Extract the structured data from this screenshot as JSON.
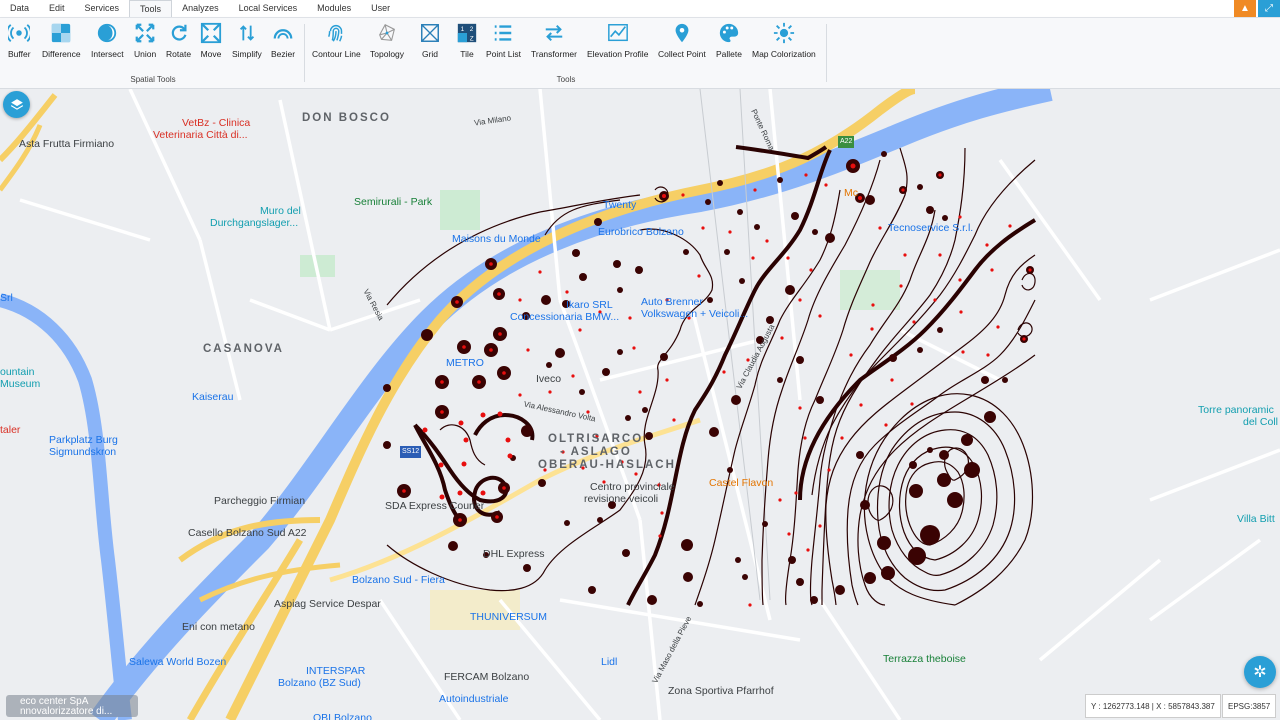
{
  "menu": {
    "tabs": [
      "Data",
      "Edit",
      "Services",
      "Tools",
      "Analyzes",
      "Local Services",
      "Modules",
      "User"
    ],
    "active_tab": "Tools"
  },
  "ribbon": {
    "spatial_tools": {
      "label": "Spatial Tools",
      "items": [
        {
          "label": "Buffer",
          "icon": "buffer-icon"
        },
        {
          "label": "Difference",
          "icon": "difference-icon"
        },
        {
          "label": "Intersect",
          "icon": "intersect-icon"
        },
        {
          "label": "Union",
          "icon": "union-icon"
        },
        {
          "label": "Rotate",
          "icon": "rotate-icon"
        },
        {
          "label": "Move",
          "icon": "move-icon"
        },
        {
          "label": "Simplify",
          "icon": "simplify-icon"
        },
        {
          "label": "Bezier",
          "icon": "bezier-icon"
        }
      ]
    },
    "tools": {
      "label": "Tools",
      "items": [
        {
          "label": "Contour Line",
          "icon": "fingerprint-icon"
        },
        {
          "label": "Topology",
          "icon": "topology-icon"
        },
        {
          "label": "Grid",
          "icon": "grid-icon"
        },
        {
          "label": "Tile",
          "icon": "tile-icon"
        },
        {
          "label": "Point List",
          "icon": "list-icon"
        },
        {
          "label": "Transformer",
          "icon": "transform-icon"
        },
        {
          "label": "Elevation Profile",
          "icon": "chart-icon"
        },
        {
          "label": "Collect Point",
          "icon": "pin-icon"
        },
        {
          "label": "Pallete",
          "icon": "palette-icon"
        },
        {
          "label": "Map Colorization",
          "icon": "sun-icon"
        }
      ]
    }
  },
  "map": {
    "districts": {
      "don_bosco": "DON BOSCO",
      "casanova": "CASANOVA",
      "oltrisarco_1": "OLTRISARCO",
      "oltrisarco_2": "- ASLAGO",
      "oltrisarco_3": "OBERAU-HASLACH"
    },
    "places": {
      "vetbz_1": "VetBz - Clinica",
      "vetbz_2": "Veterinaria Città di...",
      "asta": "Asta Frutta Firmiano",
      "muro_1": "Muro del",
      "muro_2": "Durchgangslager...",
      "semirurali": "Semirurali - Park",
      "maisons": "Maisons du Monde",
      "twenty": "Twenty",
      "eurobrico": "Eurobrico Bolzano",
      "tecnoservice": "Tecnoservice S.r.l.",
      "ikaro_1": "Ikaro SRL",
      "ikaro_2": "Concessionaria BMW...",
      "brenner_1": "Auto Brenner",
      "brenner_2": "Volkswagen + Veicoli...",
      "metro": "METRO",
      "iveco": "Iveco",
      "kaiserau": "Kaiserau",
      "mountain_1": "ountain",
      "mountain_2": "Museum",
      "parkplatz_1": "Parkplatz Burg",
      "parkplatz_2": "Sigmundskron",
      "taler": "taler",
      "parcheggio": "Parcheggio Firmian",
      "casello": "Casello Bolzano Sud A22",
      "centro_1": "Centro provinciale",
      "centro_2": "revisione veicoli",
      "sda": "SDA Express Courier",
      "dhl": "DHL Express",
      "bolzano_sud": "Bolzano Sud - Fiera",
      "castel": "Castel Flavon",
      "aspiag": "Aspiag Service Despar",
      "thuniversum": "THUNIVERSUM",
      "eni": "Eni con metano",
      "salewa": "Salewa World Bozen",
      "interspar_1": "INTERSPAR",
      "interspar_2": "Bolzano (BZ Sud)",
      "fercam": "FERCAM Bolzano",
      "autoindustriale": "Autoindustriale",
      "lidl": "Lidl",
      "zona": "Zona Sportiva Pfarrhof",
      "terrazza": "Terrazza theboise",
      "torre_1": "Torre panoramic",
      "torre_2": "del Coll",
      "villa": "Villa Bitt",
      "obi": "OBI Bolzano",
      "eco_1": "eco center SpA",
      "eco_2": "nnovalorizzatore di...",
      "mc": "Mc",
      "srl": "Srl"
    },
    "roads": {
      "via_resia": "Via Resia",
      "via_claudia": "Via Claudia Augusta",
      "via_volta": "Via Alessandro Volta",
      "via_pieve": "Via Maso della Pieve",
      "ponte_roma": "Ponte Roma",
      "via_milano": "Via Milano",
      "a22": "A22",
      "ss12": "SS12"
    }
  },
  "status": {
    "coords": "Y : 1262773.148 | X : 5857843.387",
    "epsg": "EPSG:3857"
  },
  "colors": {
    "accent": "#2a9fd6",
    "contour": "#3a0303",
    "point": "#d00000",
    "highway": "#f6cf65",
    "river": "#8ab4f8",
    "orange_button": "#f08a24"
  }
}
